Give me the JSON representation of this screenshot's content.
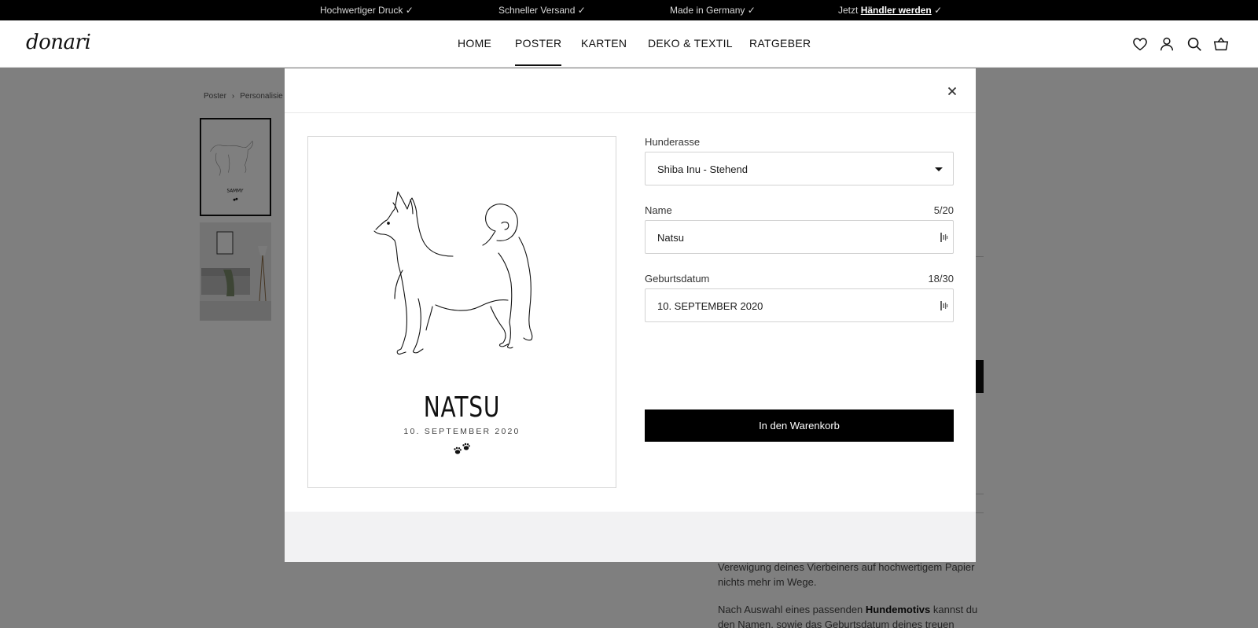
{
  "announcement": {
    "item1": "Hochwertiger Druck ✓",
    "item2": "Schneller Versand ✓",
    "item3": "Made in Germany ✓",
    "item4_prefix": "Jetzt",
    "item4_link": "Händler werden",
    "item4_suffix": "✓"
  },
  "header": {
    "logo": "donari",
    "nav": [
      "HOME",
      "POSTER",
      "KARTEN",
      "DEKO & TEXTIL",
      "RATGEBER"
    ],
    "active_nav": "POSTER",
    "icons": [
      "heart-icon",
      "account-icon",
      "search-icon",
      "basket-icon"
    ]
  },
  "breadcrumb": {
    "item1": "Poster",
    "item2": "Personalisie"
  },
  "background_text": {
    "para1": "Verewigung deines Vierbeiners auf hochwertigem Papier nichts mehr im Wege.",
    "para2_prefix": "Nach Auswahl eines passenden",
    "para2_bold": "Hundemotivs",
    "para2_suffix": "kannst du den Namen, sowie das Geburtsdatum deines treuen"
  },
  "modal": {
    "close_icon": "close-icon",
    "preview": {
      "thumb_name": "SAMMY",
      "name": "NATSU",
      "date": "10. SEPTEMBER 2020",
      "icon": "paw-icon"
    },
    "form": {
      "breed_label": "Hunderasse",
      "breed_value": "Shiba Inu - Stehend",
      "name_label": "Name",
      "name_count": "5/20",
      "name_value": "Natsu",
      "birth_label": "Geburtsdatum",
      "birth_count": "18/30",
      "birth_value": "10. SEPTEMBER 2020",
      "cart_button": "In den Warenkorb"
    }
  }
}
